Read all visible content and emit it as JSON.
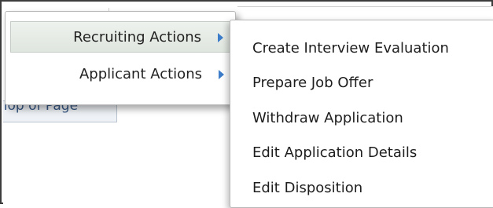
{
  "page": {
    "top_link": "Top of Page"
  },
  "menu": {
    "items": [
      {
        "label": "Recruiting Actions",
        "highlighted": true,
        "has_submenu": true
      },
      {
        "label": "Applicant Actions",
        "highlighted": false,
        "has_submenu": true
      }
    ]
  },
  "submenu": {
    "items": [
      {
        "label": "Create Interview Evaluation"
      },
      {
        "label": "Prepare Job Offer"
      },
      {
        "label": "Withdraw Application"
      },
      {
        "label": "Edit Application Details"
      },
      {
        "label": "Edit Disposition"
      }
    ]
  },
  "colors": {
    "highlight_bg": "#e3e9e3",
    "arrow": "#3d7cc9",
    "link_text": "#3a5a86"
  }
}
